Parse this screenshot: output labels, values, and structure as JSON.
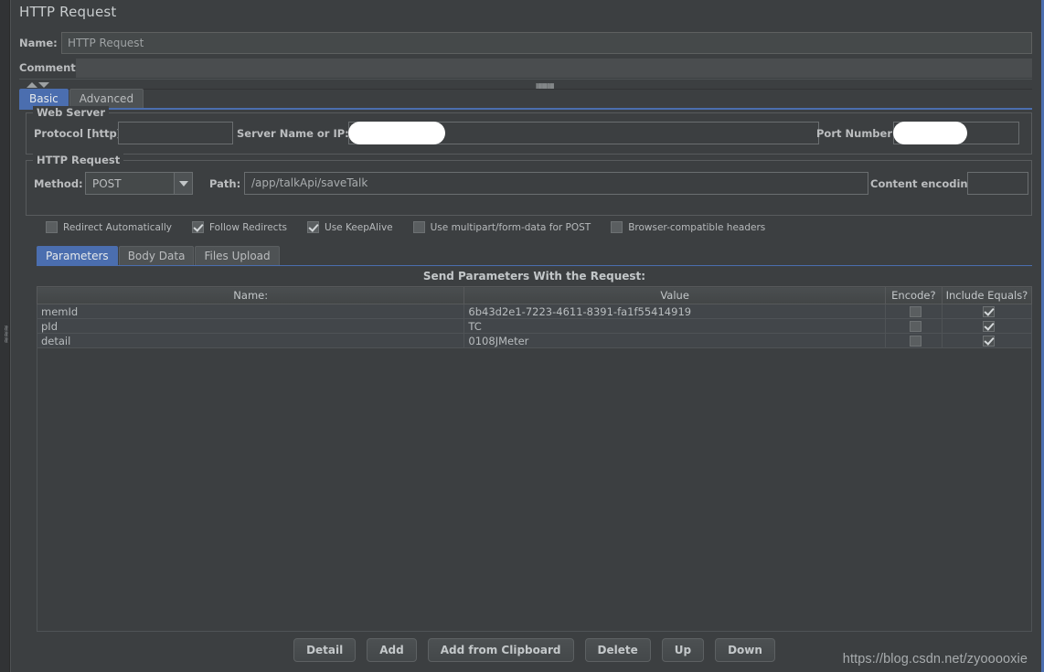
{
  "window": {
    "title": "HTTP Request"
  },
  "fields": {
    "name_label": "Name:",
    "name_value": "HTTP Request",
    "comments_label": "Comments:",
    "comments_value": ""
  },
  "top_tabs": [
    {
      "label": "Basic",
      "active": true
    },
    {
      "label": "Advanced",
      "active": false
    }
  ],
  "web_server": {
    "group_title": "Web Server",
    "protocol_label": "Protocol [http]:",
    "protocol_value": "",
    "server_label": "Server Name or IP:",
    "server_value": "",
    "server_redacted": true,
    "port_label": "Port Number:",
    "port_value": "",
    "port_redacted": true
  },
  "http_request": {
    "group_title": "HTTP Request",
    "method_label": "Method:",
    "method_value": "POST",
    "method_arrow_icon": "chevron-down-icon",
    "path_label": "Path:",
    "path_value": "/app/talkApi/saveTalk",
    "encoding_label": "Content encoding:",
    "encoding_value": ""
  },
  "options": [
    {
      "label": "Redirect Automatically",
      "checked": false
    },
    {
      "label": "Follow Redirects",
      "checked": true
    },
    {
      "label": "Use KeepAlive",
      "checked": true
    },
    {
      "label": "Use multipart/form-data for POST",
      "checked": false
    },
    {
      "label": "Browser-compatible headers",
      "checked": false
    }
  ],
  "param_tabs": [
    {
      "label": "Parameters",
      "active": true
    },
    {
      "label": "Body Data",
      "active": false
    },
    {
      "label": "Files Upload",
      "active": false
    }
  ],
  "params_table": {
    "caption": "Send Parameters With the Request:",
    "columns": [
      "Name:",
      "Value",
      "Encode?",
      "Include Equals?"
    ],
    "rows": [
      {
        "name": "memId",
        "value": "6b43d2e1-7223-4611-8391-fa1f55414919",
        "encode": false,
        "include_equals": true
      },
      {
        "name": "pId",
        "value": "TC",
        "encode": false,
        "include_equals": true
      },
      {
        "name": "detail",
        "value": "0108JMeter",
        "encode": false,
        "include_equals": true
      }
    ]
  },
  "buttons": [
    {
      "label": "Detail"
    },
    {
      "label": "Add"
    },
    {
      "label": "Add from Clipboard"
    },
    {
      "label": "Delete"
    },
    {
      "label": "Up"
    },
    {
      "label": "Down"
    }
  ],
  "watermark": {
    "text": "https://blog.csdn.net/zyooooxie"
  },
  "colors": {
    "background": "#3c3f41",
    "accent": "#4b6eaf",
    "text": "#bbbdbf",
    "field_background": "#45494a",
    "border": "#585b5d"
  }
}
